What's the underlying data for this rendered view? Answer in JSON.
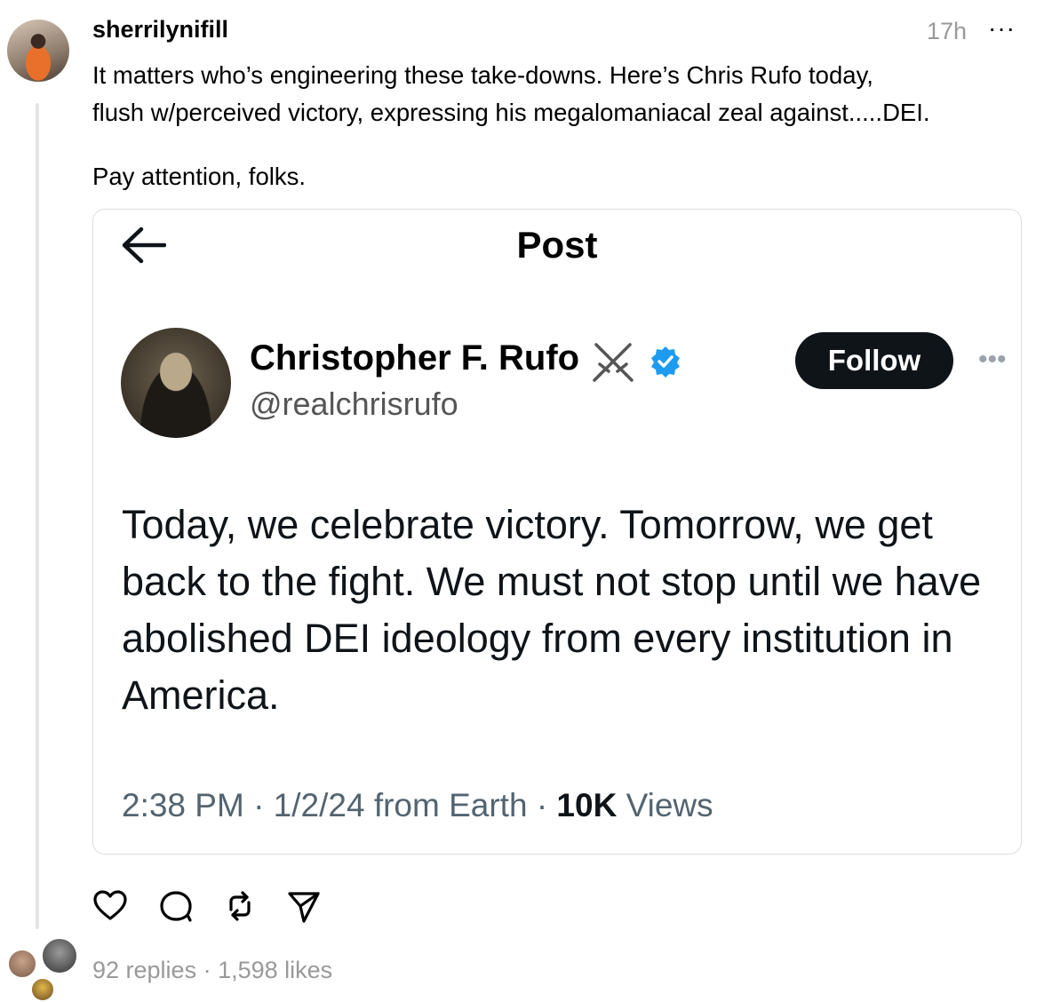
{
  "post": {
    "username": "sherrilynifill",
    "time": "17h",
    "more": "···",
    "text_line1": "It matters who’s engineering these take-downs. Here’s Chris Rufo today,",
    "text_line2": "flush w/perceived victory, expressing his megalomaniacal zeal against.....DEI.",
    "text_line3": "Pay attention, folks."
  },
  "embed": {
    "header_title": "Post",
    "author_name": "Christopher F. Rufo",
    "author_handle": "@realchrisrufo",
    "follow_label": "Follow",
    "more": "•••",
    "tweet_text": "Today, we celebrate victory. Tomorrow, we get back to the fight. We must not stop until we have abolished DEI ideology from every institution in America.",
    "meta_time": "2:38 PM · 1/2/24 from Earth · ",
    "views_count": "10K",
    "views_label": " Views",
    "verified_color": "#1d9bf0",
    "follow_bg": "#0f1419"
  },
  "icons": {
    "back": "arrow-left",
    "badge": "swords",
    "verified": "verified-check",
    "like": "heart",
    "reply": "speech-bubble",
    "repost": "repost-arrows",
    "share": "paper-plane"
  },
  "stats": {
    "replies": "92 replies",
    "separator": " · ",
    "likes": "1,598 likes"
  }
}
